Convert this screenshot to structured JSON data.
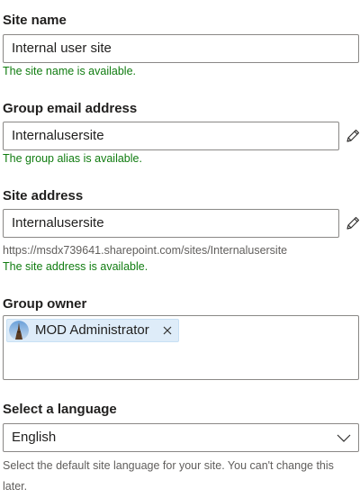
{
  "site_name": {
    "label": "Site name",
    "value": "Internal user site",
    "status": "The site name is available."
  },
  "group_email": {
    "label": "Group email address",
    "value": "Internalusersite",
    "status": "The group alias is available.",
    "edit_icon": "pencil-icon"
  },
  "site_address": {
    "label": "Site address",
    "value": "Internalusersite",
    "url": "https://msdx739641.sharepoint.com/sites/Internalusersite",
    "status": "The site address is available.",
    "edit_icon": "pencil-icon"
  },
  "group_owner": {
    "label": "Group owner",
    "owners": [
      {
        "name": "MOD Administrator",
        "remove_icon": "close-icon"
      }
    ]
  },
  "language": {
    "label": "Select a language",
    "selected": "English",
    "chevron_icon": "chevron-down-icon",
    "help": "Select the default site language for your site. You can't change this later."
  },
  "colors": {
    "success": "#107c10",
    "border": "#8a8886",
    "pill_bg": "#deecf9",
    "muted_text": "#605e5c"
  }
}
